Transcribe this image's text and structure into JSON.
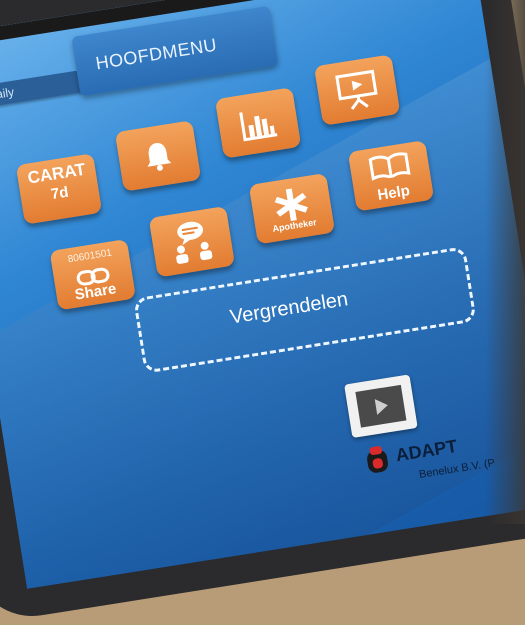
{
  "header": {
    "tab_label": "daily",
    "title": "HOOFDMENU"
  },
  "tiles": [
    {
      "name": "carat-7d",
      "line1": "CARAT",
      "line2": "7d",
      "icon": null
    },
    {
      "name": "notifications",
      "icon": "bell-icon"
    },
    {
      "name": "statistics",
      "icon": "bar-chart-icon"
    },
    {
      "name": "presentation",
      "icon": "presentation-icon"
    },
    {
      "name": "share",
      "code": "80601501",
      "label": "Share",
      "icon": "link-icon"
    },
    {
      "name": "chat",
      "icon": "chat-people-icon"
    },
    {
      "name": "pharmacist",
      "label": "Apotheker",
      "icon": "asterisk-icon"
    },
    {
      "name": "help",
      "label": "Help",
      "icon": "book-icon"
    }
  ],
  "lock": {
    "label": "Vergrendelen"
  },
  "footer": {
    "brand": "ADAPT",
    "company_text": "Benelux B.V. (P"
  },
  "colors": {
    "tile": "#e8853a",
    "background": "#2f86d3",
    "dashed_border": "#eef6ff"
  }
}
